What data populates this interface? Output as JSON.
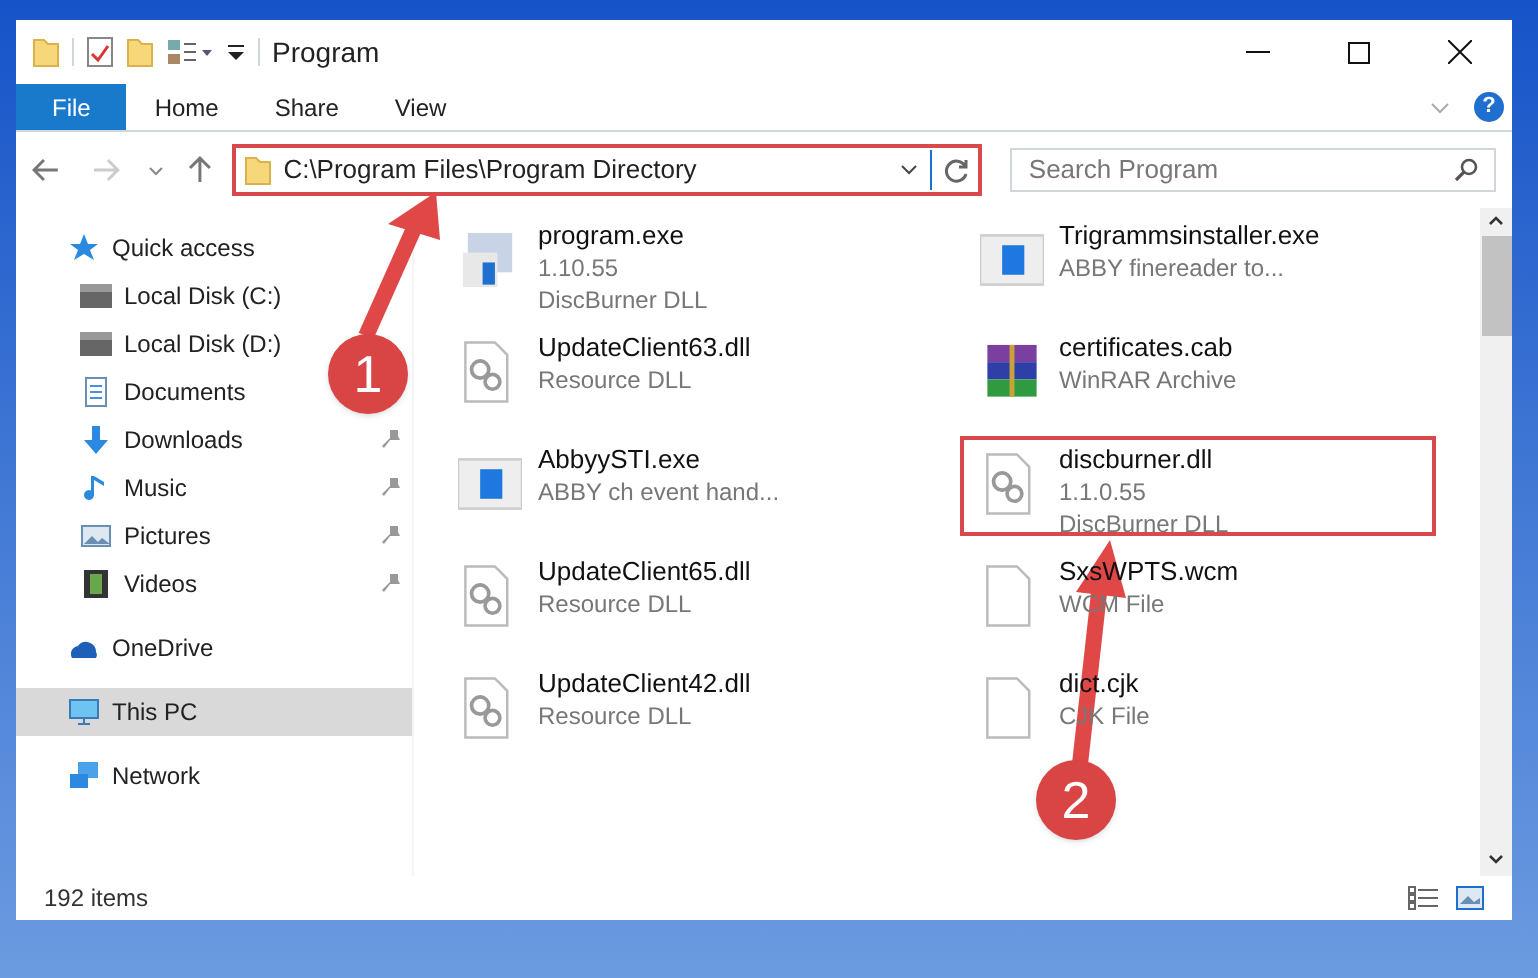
{
  "window": {
    "title": "Program"
  },
  "ribbon_tabs": [
    {
      "label": "File",
      "selected": true
    },
    {
      "label": "Home",
      "selected": false
    },
    {
      "label": "Share",
      "selected": false
    },
    {
      "label": "View",
      "selected": false
    }
  ],
  "address_bar": {
    "path": "C:\\Program Files\\Program Directory",
    "highlighted": true
  },
  "search": {
    "placeholder": "Search Program"
  },
  "help_button": {
    "label": "?"
  },
  "nav": [
    {
      "label": "Quick access",
      "kind": "star",
      "pinned": false,
      "selected": false,
      "group": true
    },
    {
      "label": "Local Disk (C:)",
      "kind": "disk",
      "pinned": false,
      "selected": false,
      "group": false
    },
    {
      "label": "Local Disk (D:)",
      "kind": "disk",
      "pinned": false,
      "selected": false,
      "group": false
    },
    {
      "label": "Documents",
      "kind": "doc",
      "pinned": false,
      "selected": false,
      "group": false
    },
    {
      "label": "Downloads",
      "kind": "download",
      "pinned": true,
      "selected": false,
      "group": false
    },
    {
      "label": "Music",
      "kind": "music",
      "pinned": true,
      "selected": false,
      "group": false
    },
    {
      "label": "Pictures",
      "kind": "picture",
      "pinned": true,
      "selected": false,
      "group": false
    },
    {
      "label": "Videos",
      "kind": "video",
      "pinned": true,
      "selected": false,
      "group": false
    },
    {
      "label": "OneDrive",
      "kind": "cloud",
      "pinned": false,
      "selected": false,
      "group": true
    },
    {
      "label": "This PC",
      "kind": "pc",
      "pinned": false,
      "selected": true,
      "group": true
    },
    {
      "label": "Network",
      "kind": "network",
      "pinned": false,
      "selected": false,
      "group": true
    }
  ],
  "files": [
    {
      "name": "program.exe",
      "lines": [
        "1.10.55",
        "DiscBurner DLL"
      ],
      "kind": "exe",
      "highlighted": false
    },
    {
      "name": "Trigrammsinstaller.exe",
      "lines": [
        "ABBY finereader to..."
      ],
      "kind": "app",
      "highlighted": false
    },
    {
      "name": "UpdateClient63.dll",
      "lines": [
        "Resource DLL"
      ],
      "kind": "dll",
      "highlighted": false
    },
    {
      "name": "certificates.cab",
      "lines": [
        "WinRAR Archive"
      ],
      "kind": "archive",
      "highlighted": false
    },
    {
      "name": "AbbyySTI.exe",
      "lines": [
        "ABBY ch event hand..."
      ],
      "kind": "app",
      "highlighted": false
    },
    {
      "name": "discburner.dll",
      "lines": [
        "1.1.0.55",
        "DiscBurner DLL"
      ],
      "kind": "dll",
      "highlighted": true
    },
    {
      "name": "UpdateClient65.dll",
      "lines": [
        "Resource DLL"
      ],
      "kind": "dll",
      "highlighted": false
    },
    {
      "name": "SxsWPTS.wcm",
      "lines": [
        "WCM File"
      ],
      "kind": "blank",
      "highlighted": false
    },
    {
      "name": "UpdateClient42.dll",
      "lines": [
        "Resource DLL"
      ],
      "kind": "dll",
      "highlighted": false
    },
    {
      "name": "dict.cjk",
      "lines": [
        "CJK File"
      ],
      "kind": "blank",
      "highlighted": false
    }
  ],
  "status_bar": {
    "count": "192 items"
  },
  "annotations": [
    {
      "label": "1"
    },
    {
      "label": "2"
    }
  ]
}
